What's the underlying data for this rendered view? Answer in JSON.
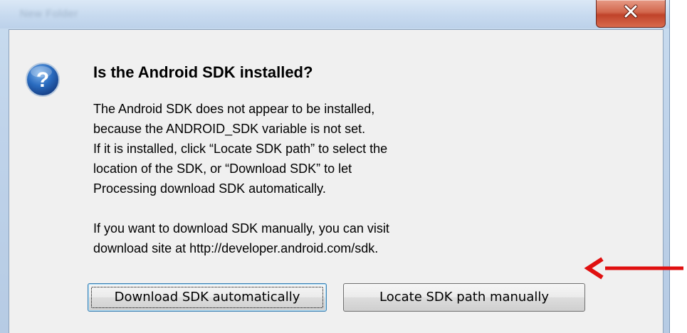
{
  "window": {
    "title": "New Folder",
    "close_icon": "close-icon"
  },
  "dialog": {
    "icon": "question-icon",
    "icon_color": "#1f5fa8",
    "heading": "Is the Android SDK installed?",
    "message_lines": [
      "The Android SDK does not appear to be installed,",
      "because the ANDROID_SDK variable is not set.",
      "If it is installed, click “Locate SDK path” to select the",
      "location of the SDK, or “Download SDK” to let",
      "Processing download SDK automatically."
    ],
    "manual_lines": [
      "If you want to download SDK manually, you can visit",
      "download site at http://developer.android.com/sdk."
    ],
    "buttons": {
      "download_label": "Download SDK automatically",
      "locate_label": "Locate SDK path manually"
    }
  },
  "annotation": {
    "arrow_icon": "red-arrow-left-icon",
    "arrow_color": "#e01010"
  }
}
